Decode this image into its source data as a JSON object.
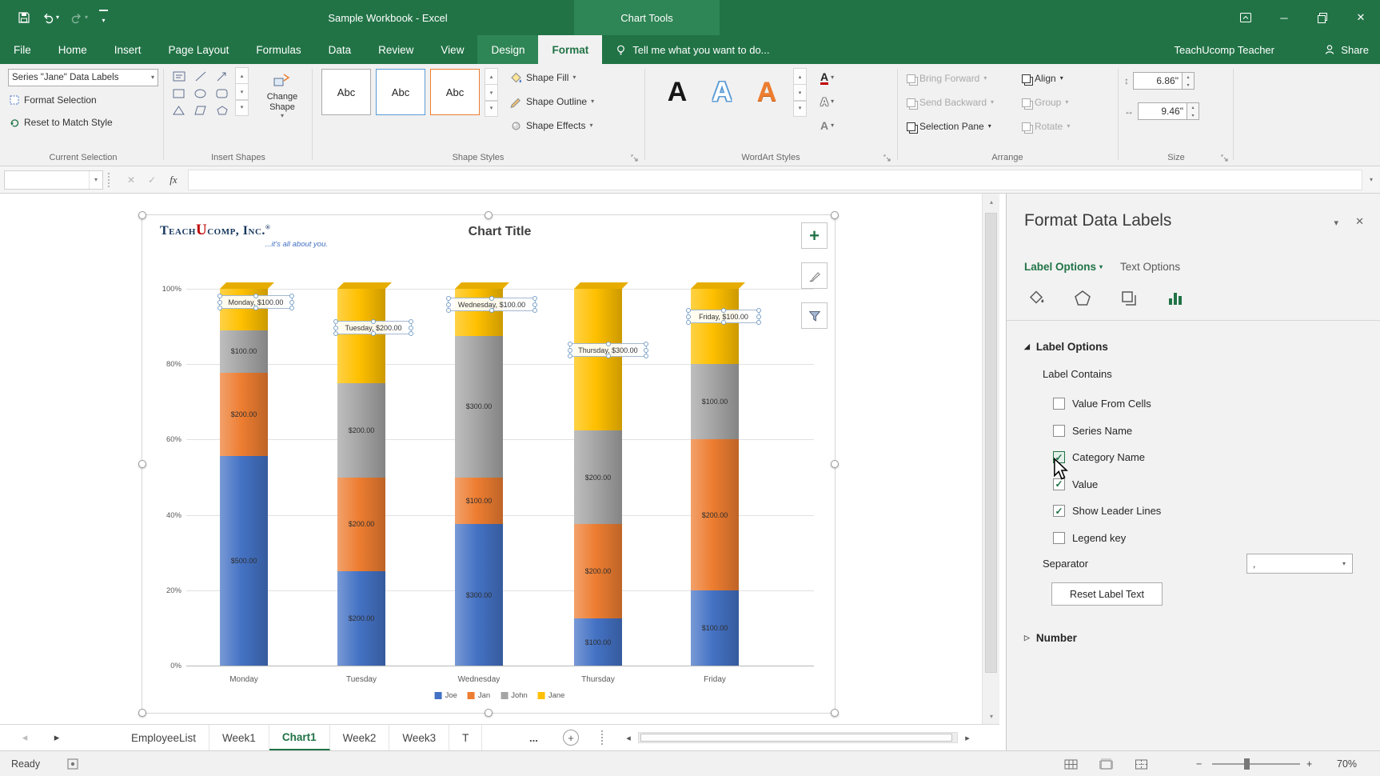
{
  "colors": {
    "excel_green": "#217346",
    "contextual_green": "#2e8555",
    "ribbon_bg": "#f1f1f1",
    "series_joe": "#4472C4",
    "series_jan": "#ED7D31",
    "series_john": "#A5A5A5",
    "series_jane": "#FFC000"
  },
  "icons": {
    "dropdown_caret": "▾",
    "close": "✕",
    "check": "✓",
    "cancel": "✕",
    "expanded_triangle": "◢",
    "collapsed_triangle": "▷",
    "nav_left": "◂",
    "nav_right": "▸",
    "scroll_up": "▴",
    "scroll_down": "▾",
    "minimize": "─",
    "plus": "+"
  },
  "titlebar": {
    "title": "Sample Workbook - Excel",
    "context_label": "Chart Tools"
  },
  "ribbon_tabs": [
    {
      "label": "File",
      "type": "file",
      "active": false
    },
    {
      "label": "Home",
      "type": "normal",
      "active": false
    },
    {
      "label": "Insert",
      "type": "normal",
      "active": false
    },
    {
      "label": "Page Layout",
      "type": "normal",
      "active": false
    },
    {
      "label": "Formulas",
      "type": "normal",
      "active": false
    },
    {
      "label": "Data",
      "type": "normal",
      "active": false
    },
    {
      "label": "Review",
      "type": "normal",
      "active": false
    },
    {
      "label": "View",
      "type": "normal",
      "active": false
    },
    {
      "label": "Design",
      "type": "contextual",
      "active": false
    },
    {
      "label": "Format",
      "type": "contextual",
      "active": true
    }
  ],
  "tell_me": "Tell me what you want to do...",
  "account_name": "TeachUcomp Teacher",
  "share_label": "Share",
  "ribbon": {
    "current_selection": {
      "label": "Current Selection",
      "selection": "Series \"Jane\" Data Labels",
      "format_selection": "Format Selection",
      "reset": "Reset to Match Style"
    },
    "insert_shapes": {
      "label": "Insert Shapes",
      "change_shape": "Change Shape"
    },
    "shape_styles": {
      "label": "Shape Styles",
      "presets": [
        "Abc",
        "Abc",
        "Abc"
      ],
      "fill": "Shape Fill",
      "outline": "Shape Outline",
      "effects": "Shape Effects"
    },
    "wordart": {
      "label": "WordArt Styles",
      "presets": [
        "A",
        "A",
        "A"
      ]
    },
    "arrange": {
      "label": "Arrange",
      "buttons": [
        {
          "label": "Bring Forward",
          "enabled": false
        },
        {
          "label": "Send Backward",
          "enabled": false
        },
        {
          "label": "Selection Pane",
          "enabled": true
        },
        {
          "label": "Align",
          "enabled": true
        },
        {
          "label": "Group",
          "enabled": false
        },
        {
          "label": "Rotate",
          "enabled": false
        }
      ]
    },
    "size": {
      "label": "Size",
      "height": "6.86\"",
      "width": "9.46\""
    }
  },
  "formula_bar": {
    "name_box": "",
    "fx": "fx"
  },
  "chart_data": {
    "type": "bar",
    "subtype": "100%-stacked-column-3d",
    "title": "Chart Title",
    "categories": [
      "Monday",
      "Tuesday",
      "Wednesday",
      "Thursday",
      "Friday"
    ],
    "series": [
      {
        "name": "Joe",
        "color": "#4472C4",
        "values": [
          500,
          200,
          300,
          100,
          100
        ]
      },
      {
        "name": "Jan",
        "color": "#ED7D31",
        "values": [
          200,
          200,
          100,
          200,
          200
        ]
      },
      {
        "name": "John",
        "color": "#A5A5A5",
        "values": [
          100,
          200,
          300,
          200,
          100
        ]
      },
      {
        "name": "Jane",
        "color": "#FFC000",
        "values": [
          100,
          200,
          100,
          300,
          100
        ]
      }
    ],
    "y_ticks": [
      "0%",
      "20%",
      "40%",
      "60%",
      "80%",
      "100%"
    ],
    "ylim": [
      "0%",
      "100%"
    ],
    "grid": true,
    "legend_position": "bottom",
    "selected_series": "Jane",
    "selected_labels": [
      "Monday, $100.00",
      "Tuesday, $200.00",
      "Wednesday, $100.00",
      "Thursday, $300.00",
      "Friday, $100.00"
    ],
    "logo": {
      "part1": "Teach",
      "part2": "U",
      "part3": "comp, Inc.",
      "reg": "®",
      "tagline": "...it's all about you."
    }
  },
  "task_pane": {
    "title": "Format Data Labels",
    "tab_label_options": "Label Options",
    "tab_text_options": "Text Options",
    "section_label_options": "Label Options",
    "label_contains": "Label Contains",
    "checkboxes": [
      {
        "label": "Value From Cells",
        "checked": false
      },
      {
        "label": "Series Name",
        "checked": false
      },
      {
        "label": "Category Name",
        "checked": true
      },
      {
        "label": "Value",
        "checked": true
      },
      {
        "label": "Show Leader Lines",
        "checked": true
      },
      {
        "label": "Legend key",
        "checked": false
      }
    ],
    "separator_label": "Separator",
    "separator_value": ",",
    "reset_button": "Reset Label Text",
    "number_section": "Number"
  },
  "sheet_tabs": {
    "tabs": [
      {
        "name": "EmployeeList",
        "active": false
      },
      {
        "name": "Week1",
        "active": false
      },
      {
        "name": "Chart1",
        "active": true
      },
      {
        "name": "Week2",
        "active": false
      },
      {
        "name": "Week3",
        "active": false
      },
      {
        "name": "T",
        "active": false
      }
    ],
    "overflow": "...",
    "add": "+"
  },
  "status_bar": {
    "ready": "Ready",
    "zoom": "70%",
    "zoom_minus": "−",
    "zoom_plus": "+"
  }
}
